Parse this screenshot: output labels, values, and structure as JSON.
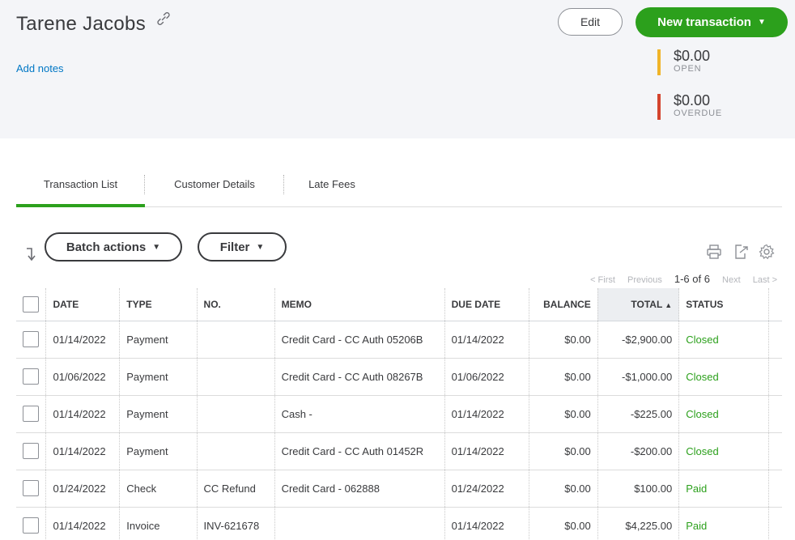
{
  "customer": {
    "name": "Tarene Jacobs",
    "add_notes": "Add notes"
  },
  "actions": {
    "edit_label": "Edit",
    "new_transaction_label": "New transaction"
  },
  "summary": {
    "open": {
      "amount": "$0.00",
      "label": "OPEN",
      "color": "#f0b429"
    },
    "overdue": {
      "amount": "$0.00",
      "label": "OVERDUE",
      "color": "#d4442e"
    }
  },
  "tabs": [
    {
      "label": "Transaction List",
      "active": true
    },
    {
      "label": "Customer Details",
      "active": false
    },
    {
      "label": "Late Fees",
      "active": false
    }
  ],
  "toolbar": {
    "batch_actions_label": "Batch actions",
    "filter_label": "Filter"
  },
  "pagination": {
    "first": "< First",
    "previous": "Previous",
    "range": "1-6 of 6",
    "next": "Next",
    "last": "Last >"
  },
  "table": {
    "columns": [
      "DATE",
      "TYPE",
      "NO.",
      "MEMO",
      "DUE DATE",
      "BALANCE",
      "TOTAL",
      "STATUS"
    ],
    "rows": [
      {
        "date": "01/14/2022",
        "type": "Payment",
        "no": "",
        "memo": "Credit Card - CC Auth 05206B",
        "due_date": "01/14/2022",
        "balance": "$0.00",
        "total": "-$2,900.00",
        "status": "Closed"
      },
      {
        "date": "01/06/2022",
        "type": "Payment",
        "no": "",
        "memo": "Credit Card - CC Auth 08267B",
        "due_date": "01/06/2022",
        "balance": "$0.00",
        "total": "-$1,000.00",
        "status": "Closed"
      },
      {
        "date": "01/14/2022",
        "type": "Payment",
        "no": "",
        "memo": "Cash -",
        "due_date": "01/14/2022",
        "balance": "$0.00",
        "total": "-$225.00",
        "status": "Closed"
      },
      {
        "date": "01/14/2022",
        "type": "Payment",
        "no": "",
        "memo": "Credit Card - CC Auth 01452R",
        "due_date": "01/14/2022",
        "balance": "$0.00",
        "total": "-$200.00",
        "status": "Closed"
      },
      {
        "date": "01/24/2022",
        "type": "Check",
        "no": "CC Refund",
        "memo": "Credit Card - 062888",
        "due_date": "01/24/2022",
        "balance": "$0.00",
        "total": "$100.00",
        "status": "Paid"
      },
      {
        "date": "01/14/2022",
        "type": "Invoice",
        "no": "INV-621678",
        "memo": "",
        "due_date": "01/14/2022",
        "balance": "$0.00",
        "total": "$4,225.00",
        "status": "Paid"
      }
    ]
  },
  "colors": {
    "brand_green": "#2ca01c",
    "link_blue": "#0077c5"
  }
}
